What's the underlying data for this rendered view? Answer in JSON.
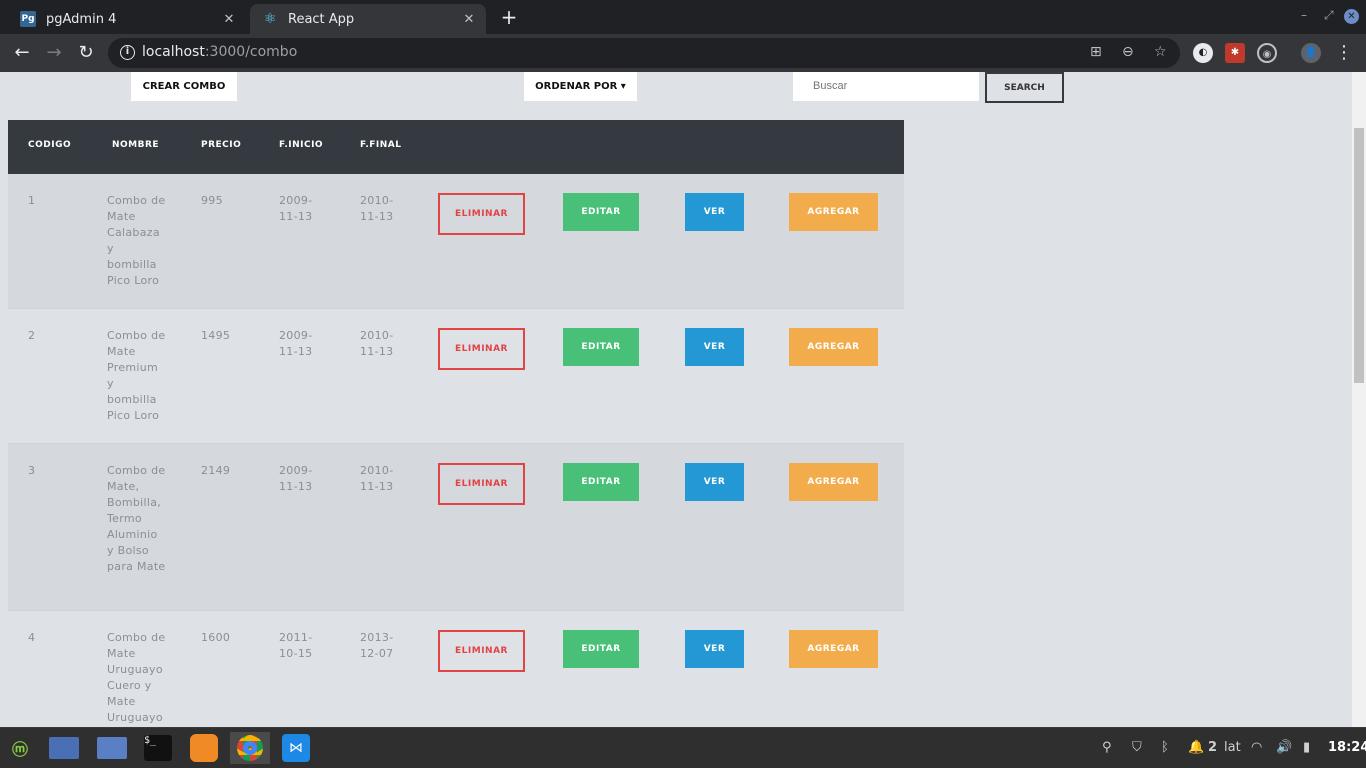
{
  "browser": {
    "tabs": [
      {
        "title": "pgAdmin 4",
        "favicon": "Pg"
      },
      {
        "title": "React App",
        "favicon": "⚛"
      }
    ],
    "url_host": "localhost",
    "url_rest": ":3000/combo"
  },
  "controls": {
    "crear_combo": "CREAR COMBO",
    "ordenar_por": "ORDENAR POR ▾",
    "search_placeholder": "Buscar",
    "search_button": "SEARCH"
  },
  "table": {
    "headers": [
      "CODIGO",
      "NOMBRE",
      "PRECIO",
      "F.INICIO",
      "F.FINAL"
    ],
    "rows": [
      {
        "codigo": "1",
        "nombre": "Combo de Mate Calabaza y bombilla Pico Loro",
        "precio": "995",
        "inicio": "2009-11-13",
        "final": "2010-11-13"
      },
      {
        "codigo": "2",
        "nombre": "Combo de Mate Premium y bombilla Pico Loro",
        "precio": "1495",
        "inicio": "2009-11-13",
        "final": "2010-11-13"
      },
      {
        "codigo": "3",
        "nombre": "Combo de Mate, Bombilla, Termo Aluminio y Bolso para Mate",
        "precio": "2149",
        "inicio": "2009-11-13",
        "final": "2010-11-13"
      },
      {
        "codigo": "4",
        "nombre": "Combo de Mate Uruguayo Cuero y Mate Uruguayo",
        "precio": "1600",
        "inicio": "2011-10-15",
        "final": "2013-12-07"
      }
    ],
    "actions": {
      "eliminar": "ELIMINAR",
      "editar": "EDITAR",
      "ver": "VER",
      "agregar": "AGREGAR"
    }
  },
  "taskbar": {
    "workspace": "2",
    "keyboard": "lat",
    "clock": "18:24"
  }
}
